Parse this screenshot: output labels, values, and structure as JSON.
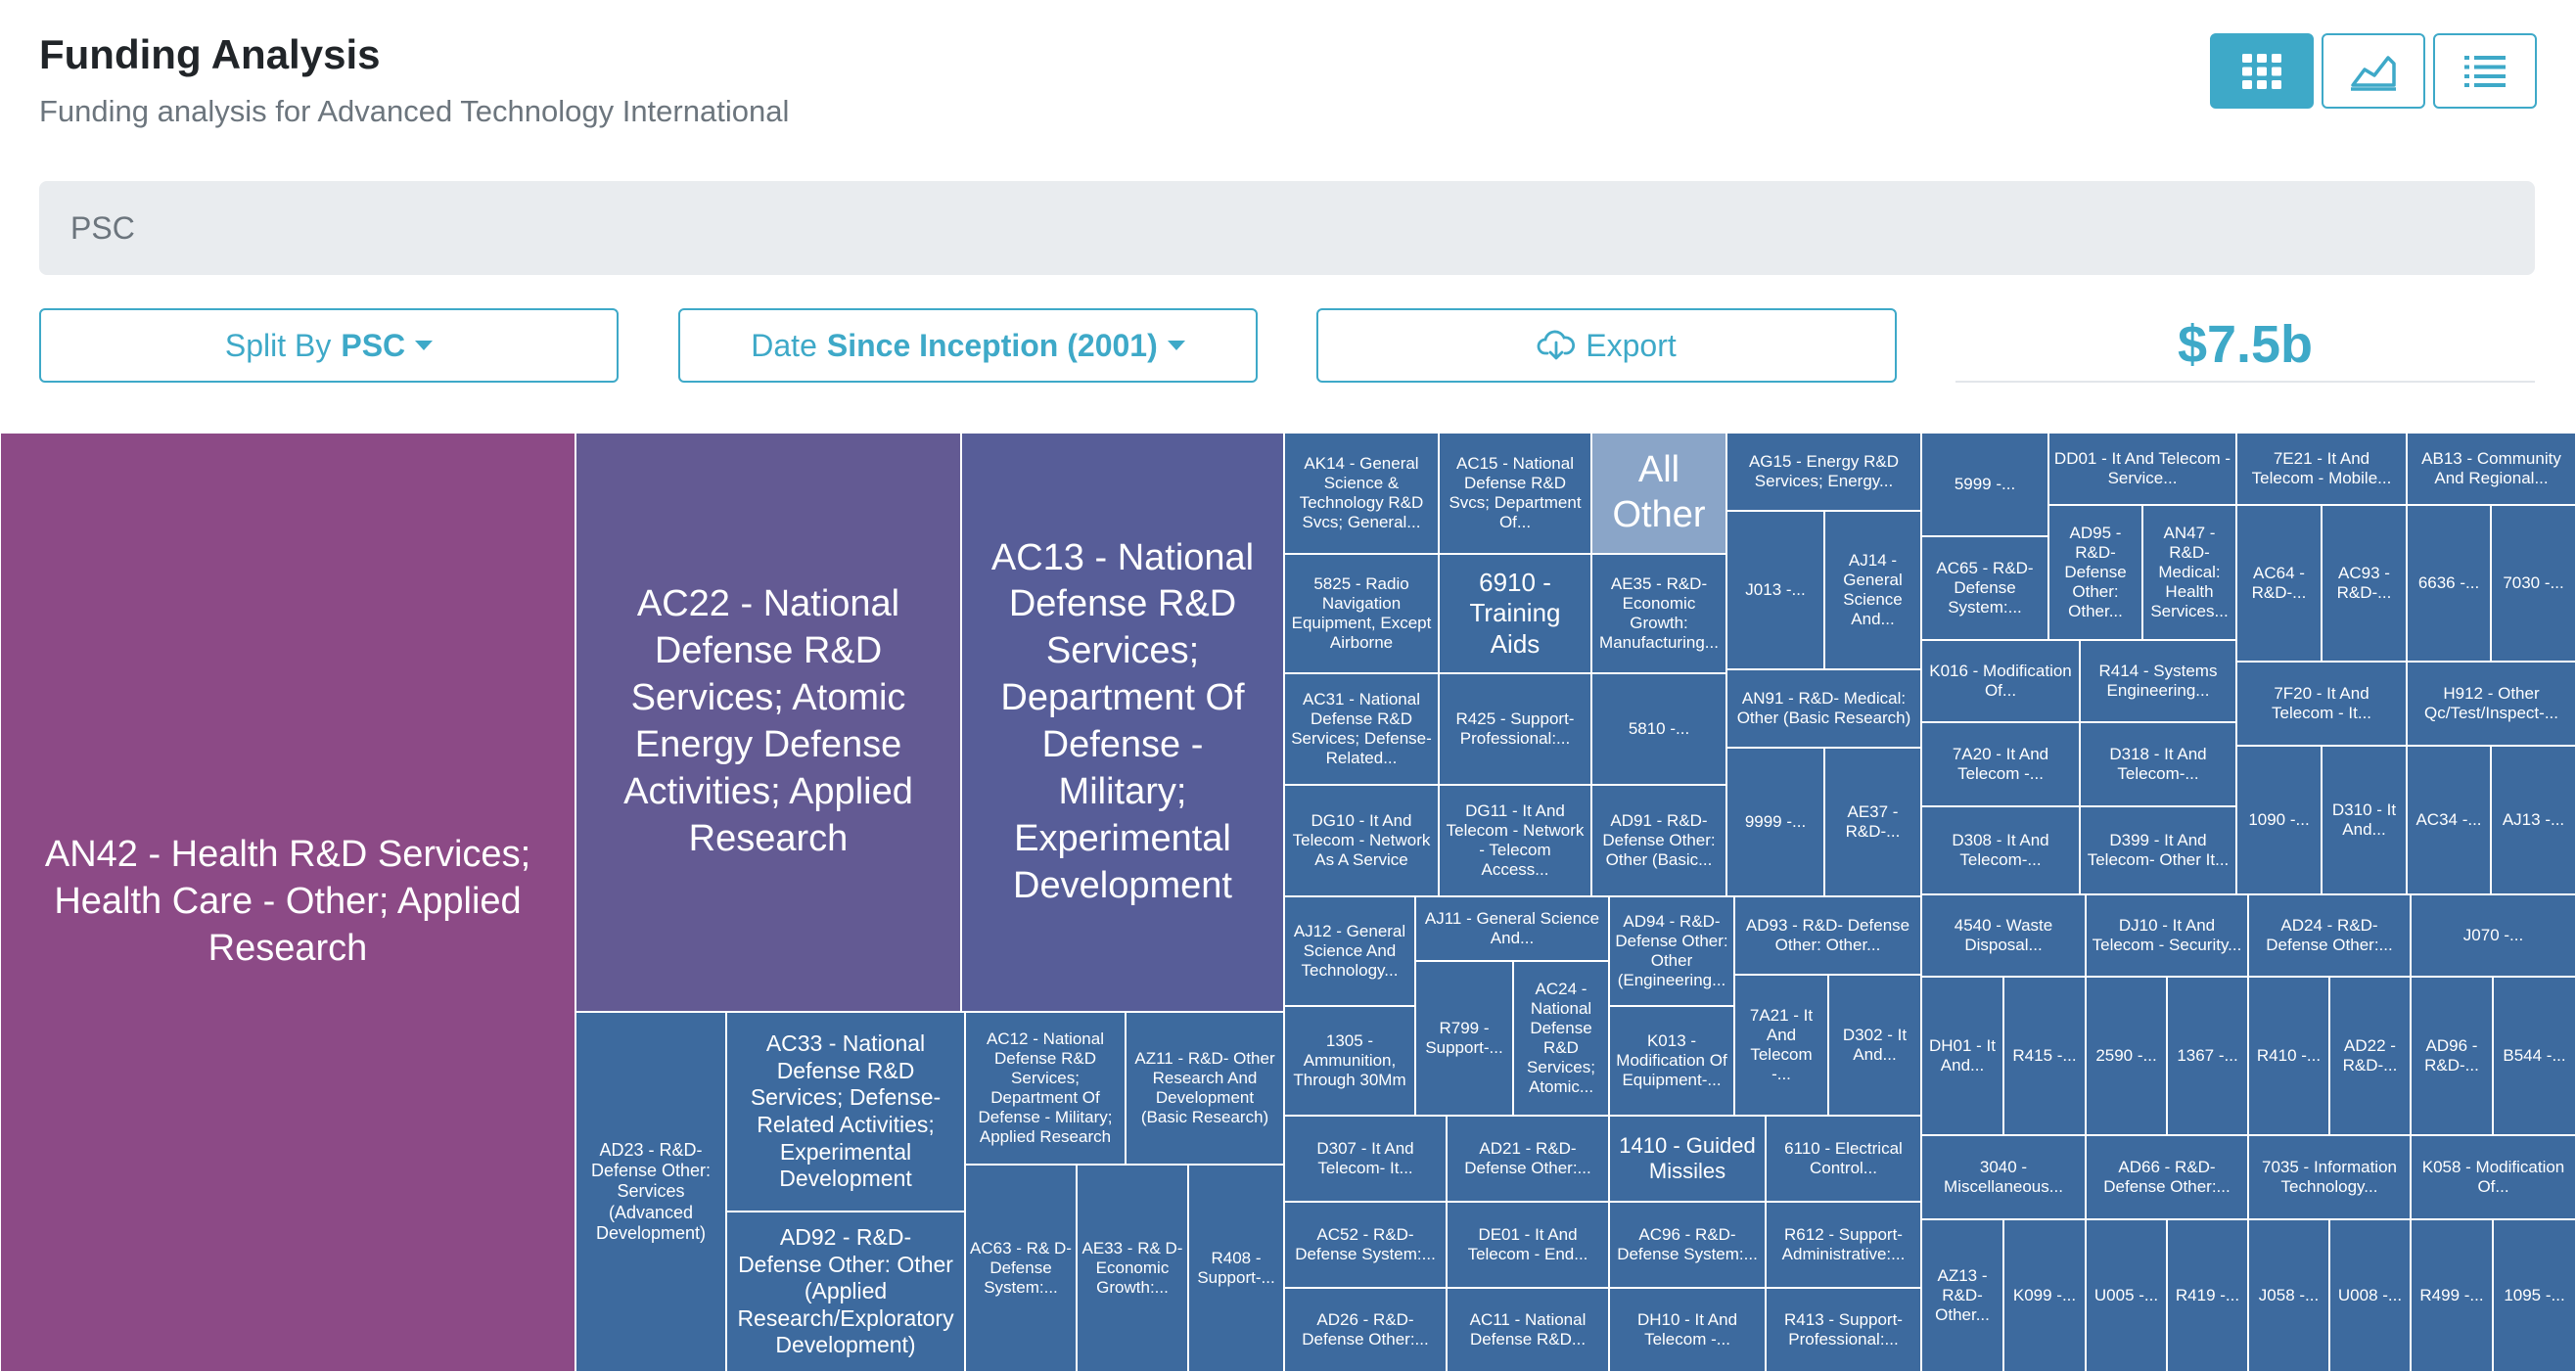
{
  "header": {
    "title": "Funding Analysis",
    "subtitle": "Funding analysis for Advanced Technology International"
  },
  "view_buttons": [
    {
      "icon": "grid-icon",
      "active": true
    },
    {
      "icon": "area-chart-icon",
      "active": false
    },
    {
      "icon": "list-icon",
      "active": false
    }
  ],
  "search": {
    "value": "PSC"
  },
  "controls": {
    "split_label": "Split By",
    "split_value": "PSC",
    "date_label": "Date",
    "date_value": "Since Inception (2001)",
    "export_label": "Export",
    "total": "$7.5b"
  },
  "colors": {
    "accent": "#3ea9c8",
    "tile_default": "#3d6a9e",
    "tile_all_other": "#8aa5c8"
  },
  "treemap": {
    "tiles": [
      {
        "label": "AN42 - Health R&D Services; Health Care - Other; Applied Research",
        "color": "#8c4a86"
      },
      {
        "label": "AC22 - National Defense R&D Services; Atomic Energy Defense Activities; Applied Research",
        "color": "#635a93"
      },
      {
        "label": "AC13 - National Defense R&D Services; Department Of Defense - Military; Experimental Development",
        "color": "#575d98"
      },
      {
        "label": "AD23 - R&D- Defense Other: Services (Advanced Development)"
      },
      {
        "label": "AC33 - National Defense R&D Services; Defense-Related Activities; Experimental Development"
      },
      {
        "label": "AD92 - R&D- Defense Other: Other (Applied Research/Exploratory Development)"
      },
      {
        "label": "AC12 - National Defense R&D Services; Department Of Defense - Military; Applied Research"
      },
      {
        "label": "AZ11 - R&D- Other Research And Development (Basic Research)"
      },
      {
        "label": "AC63 - R& D- Defense System:..."
      },
      {
        "label": "AE33 - R& D- Economic Growth:..."
      },
      {
        "label": "R408 - Support-..."
      },
      {
        "label": "AK14 - General Science & Technology R&D Svcs; General..."
      },
      {
        "label": "AC15 - National Defense R&D Svcs; Department Of..."
      },
      {
        "label": "All Other"
      },
      {
        "label": "AG15 - Energy R&D Services; Energy..."
      },
      {
        "label": "5825 - Radio Navigation Equipment, Except Airborne"
      },
      {
        "label": "6910 - Training Aids"
      },
      {
        "label": "AE35 - R&D- Economic Growth: Manufacturing..."
      },
      {
        "label": "J013 -..."
      },
      {
        "label": "AJ14 - General Science And..."
      },
      {
        "label": "AC31 - National Defense R&D Services; Defense-Related..."
      },
      {
        "label": "R425 - Support- Professional:..."
      },
      {
        "label": "5810 -..."
      },
      {
        "label": "AN91 - R&D- Medical: Other (Basic Research)"
      },
      {
        "label": "DG10 - It And Telecom - Network As A Service"
      },
      {
        "label": "DG11 - It And Telecom - Network - Telecom Access..."
      },
      {
        "label": "AD91 - R&D- Defense Other: Other (Basic..."
      },
      {
        "label": "9999 -..."
      },
      {
        "label": "AE37 - R&D-..."
      },
      {
        "label": "AJ12 - General Science And Technology..."
      },
      {
        "label": "AJ11 - General Science And..."
      },
      {
        "label": "AD94 - R&D- Defense Other: Other (Engineering..."
      },
      {
        "label": "AD93 - R&D- Defense Other: Other..."
      },
      {
        "label": "1305 - Ammunition, Through 30Mm"
      },
      {
        "label": "R799 - Support-..."
      },
      {
        "label": "AC24 - National Defense R&D Services; Atomic..."
      },
      {
        "label": "K013 - Modification Of Equipment-..."
      },
      {
        "label": "7A21 - It And Telecom -..."
      },
      {
        "label": "D302 - It And..."
      },
      {
        "label": "D307 - It And Telecom- It..."
      },
      {
        "label": "AD21 - R&D- Defense Other:..."
      },
      {
        "label": "1410 - Guided Missiles"
      },
      {
        "label": "6110 - Electrical Control..."
      },
      {
        "label": "AC52 - R&D- Defense System:..."
      },
      {
        "label": "DE01 - It And Telecom - End..."
      },
      {
        "label": "AC96 - R&D- Defense System:..."
      },
      {
        "label": "R612 - Support- Administrative:..."
      },
      {
        "label": "AD26 - R&D- Defense Other:..."
      },
      {
        "label": "AC11 - National Defense R&D..."
      },
      {
        "label": "DH10 - It And Telecom -..."
      },
      {
        "label": "R413 - Support- Professional:..."
      },
      {
        "label": "5999 -..."
      },
      {
        "label": "DD01 - It And Telecom - Service..."
      },
      {
        "label": "7E21 - It And Telecom - Mobile..."
      },
      {
        "label": "AB13 - Community And Regional..."
      },
      {
        "label": "AC65 - R&D- Defense System:..."
      },
      {
        "label": "AD95 - R&D- Defense Other: Other..."
      },
      {
        "label": "AN47 - R&D- Medical: Health Services..."
      },
      {
        "label": "AC64 - R&D-..."
      },
      {
        "label": "AC93 - R&D-..."
      },
      {
        "label": "6636 -..."
      },
      {
        "label": "7030 -..."
      },
      {
        "label": "K016 - Modification Of..."
      },
      {
        "label": "R414 - Systems Engineering..."
      },
      {
        "label": "7F20 - It And Telecom - It..."
      },
      {
        "label": "H912 - Other Qc/Test/Inspect-..."
      },
      {
        "label": "7A20 - It And Telecom -..."
      },
      {
        "label": "D318 - It And Telecom-..."
      },
      {
        "label": "1090 -..."
      },
      {
        "label": "D310 - It And..."
      },
      {
        "label": "AC34 -..."
      },
      {
        "label": "AJ13 -..."
      },
      {
        "label": "D308 - It And Telecom-..."
      },
      {
        "label": "D399 - It And Telecom- Other It..."
      },
      {
        "label": "4540 - Waste Disposal..."
      },
      {
        "label": "DJ10 - It And Telecom - Security..."
      },
      {
        "label": "AD24 - R&D- Defense Other:..."
      },
      {
        "label": "J070 -..."
      },
      {
        "label": "DH01 - It And..."
      },
      {
        "label": "R415 -..."
      },
      {
        "label": "2590 -..."
      },
      {
        "label": "1367 -..."
      },
      {
        "label": "R410 -..."
      },
      {
        "label": "AD22 - R&D-..."
      },
      {
        "label": "AD96 - R&D-..."
      },
      {
        "label": "B544 -..."
      },
      {
        "label": "3040 - Miscellaneous..."
      },
      {
        "label": "AD66 - R&D- Defense Other:..."
      },
      {
        "label": "7035 - Information Technology..."
      },
      {
        "label": "K058 - Modification Of..."
      },
      {
        "label": "AZ13 - R&D- Other..."
      },
      {
        "label": "K099 -..."
      },
      {
        "label": "U005 -..."
      },
      {
        "label": "R419 -..."
      },
      {
        "label": "J058 -..."
      },
      {
        "label": "U008 -..."
      },
      {
        "label": "R499 -..."
      },
      {
        "label": "1095 -..."
      }
    ]
  }
}
